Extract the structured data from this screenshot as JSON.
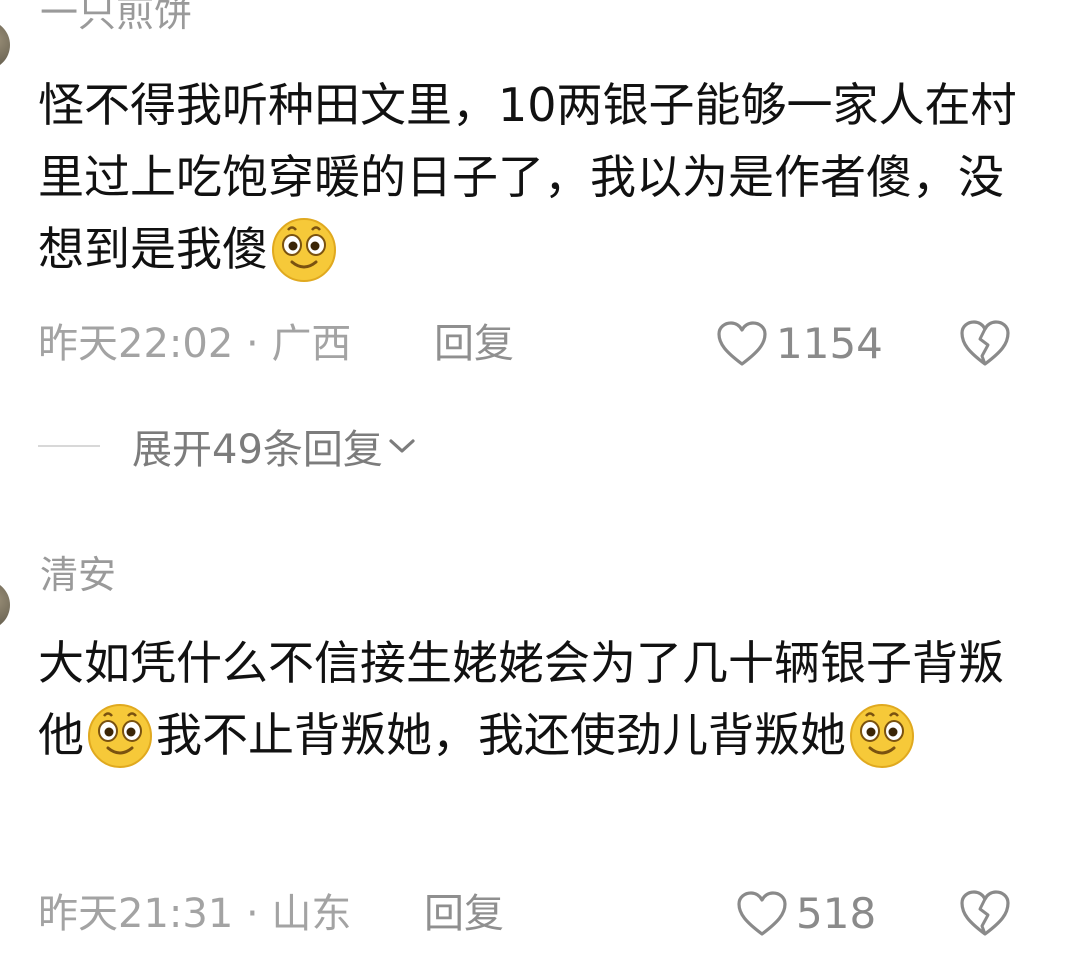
{
  "comments": [
    {
      "username": "一只煎饼",
      "text_parts": [
        "怪不得我听种田文里，10两银子能够一家人在村里过上吃饱穿暖的日子了，我以为是作者傻，没想到是我傻"
      ],
      "time": "昨天22:02",
      "separator": "·",
      "location": "广西",
      "reply_label": "回复",
      "likes": "1154",
      "icons": [
        "heart-icon",
        "broken-heart-icon"
      ]
    },
    {
      "username": "清安",
      "text_parts": [
        "大如凭什么不信接生姥姥会为了几十辆银子背叛他",
        "我不止背叛她，我还使劲儿背叛她"
      ],
      "time": "昨天21:31",
      "separator": "·",
      "location": "山东",
      "reply_label": "回复",
      "likes": "518",
      "icons": [
        "heart-icon",
        "broken-heart-icon"
      ]
    }
  ],
  "expand_replies": {
    "label": "展开49条回复",
    "icon": "chevron-down-icon"
  },
  "emoji_name": "smiling-face-emoji",
  "colors": {
    "meta": "#a3a3a3",
    "emoji_fill": "#f6c939",
    "text": "#111111"
  }
}
